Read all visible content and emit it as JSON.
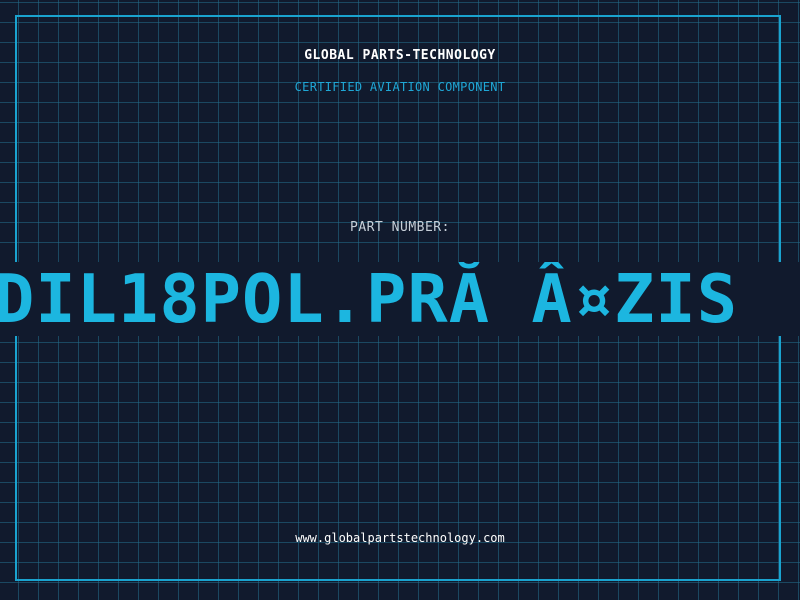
{
  "header": {
    "company": "GLOBAL PARTS-TECHNOLOGY",
    "subtitle": "CERTIFIED AVIATION COMPONENT"
  },
  "part": {
    "label": "PART NUMBER:",
    "number": "DIL18POL.PRĂ Â¤ZIS"
  },
  "footer": {
    "website": "www.globalpartstechnology.com"
  },
  "colors": {
    "background": "#111a2d",
    "grid": "#236e8c",
    "accent": "#1cb6e0",
    "frame": "#1aa3cf",
    "text": "#ffffff",
    "label": "#c7cfd8"
  }
}
